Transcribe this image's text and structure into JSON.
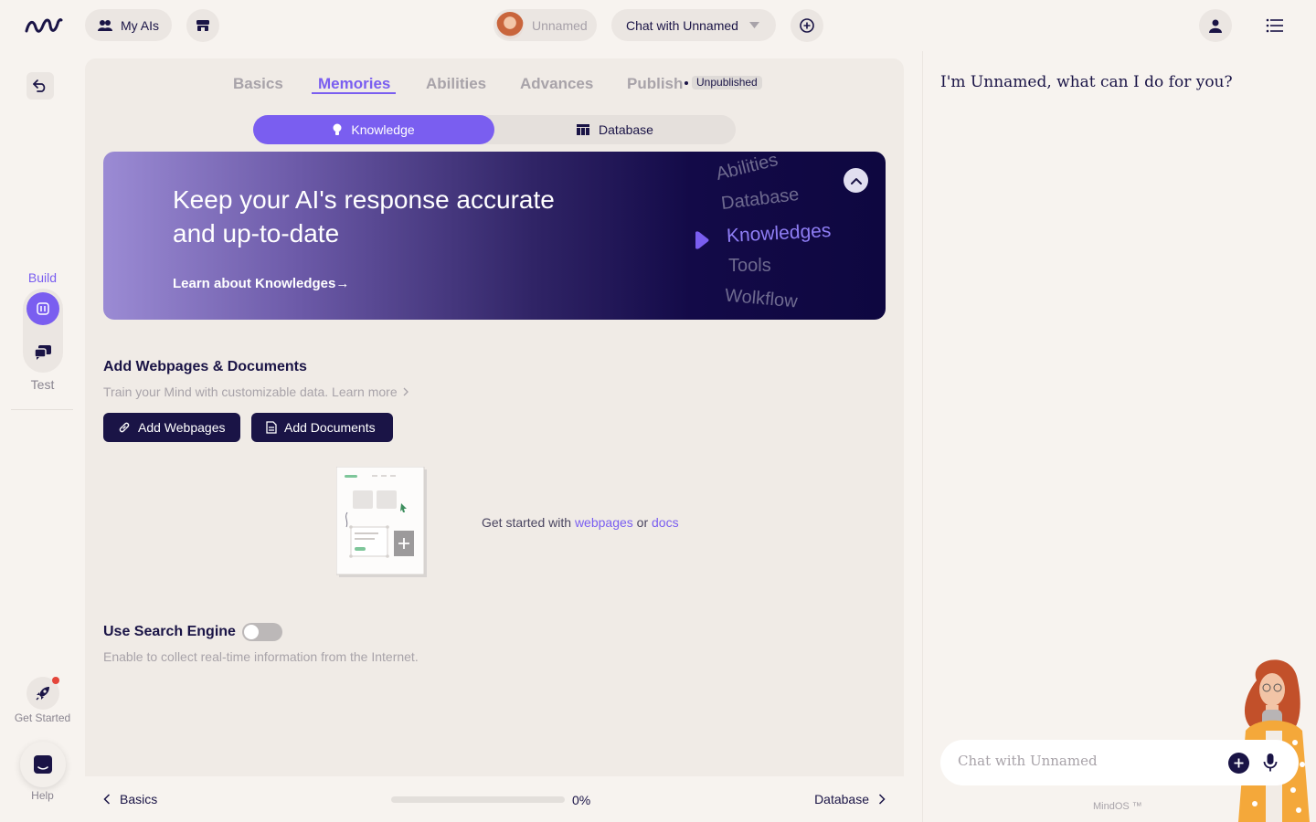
{
  "topbar": {
    "my_ais_label": "My AIs",
    "ai_name": "Unnamed",
    "chat_select_label": "Chat with Unnamed"
  },
  "rail": {
    "build_label": "Build",
    "test_label": "Test",
    "get_started_label": "Get Started",
    "help_label": "Help"
  },
  "tabs": [
    {
      "label": "Basics",
      "active": false
    },
    {
      "label": "Memories",
      "active": true
    },
    {
      "label": "Abilities",
      "active": false
    },
    {
      "label": "Advances",
      "active": false
    },
    {
      "label": "Publish",
      "active": false
    }
  ],
  "publish_badge": "Unpublished",
  "segments": {
    "knowledge": "Knowledge",
    "database": "Database",
    "active": "knowledge"
  },
  "banner": {
    "title": "Keep your AI's response accurate and up-to-date",
    "link": "Learn about Knowledges→",
    "wheel": [
      "Abilities",
      "Database",
      "Knowledges",
      "Tools",
      "Wolkflow"
    ],
    "wheel_active": "Knowledges"
  },
  "webpages_section": {
    "title": "Add Webpages & Documents",
    "subtitle": "Train your Mind with customizable data. Learn more",
    "add_webpages": "Add Webpages",
    "add_documents": "Add Documents",
    "empty_prefix": "Get started with",
    "empty_link1": "webpages",
    "empty_or": "or",
    "empty_link2": "docs"
  },
  "search_engine": {
    "title": "Use Search Engine",
    "subtitle": "Enable to collect real-time information from the Internet.",
    "enabled": false
  },
  "footer": {
    "prev_label": "Basics",
    "next_label": "Database",
    "progress_percent": 0,
    "progress_label": "0%"
  },
  "chat": {
    "greeting": "I'm Unnamed, what can I do for you?",
    "placeholder": "Chat with Unnamed",
    "brand": "MindOS ™"
  },
  "colors": {
    "accent": "#7a5ef0",
    "navy": "#1a1446",
    "background": "#f7f3ef"
  }
}
